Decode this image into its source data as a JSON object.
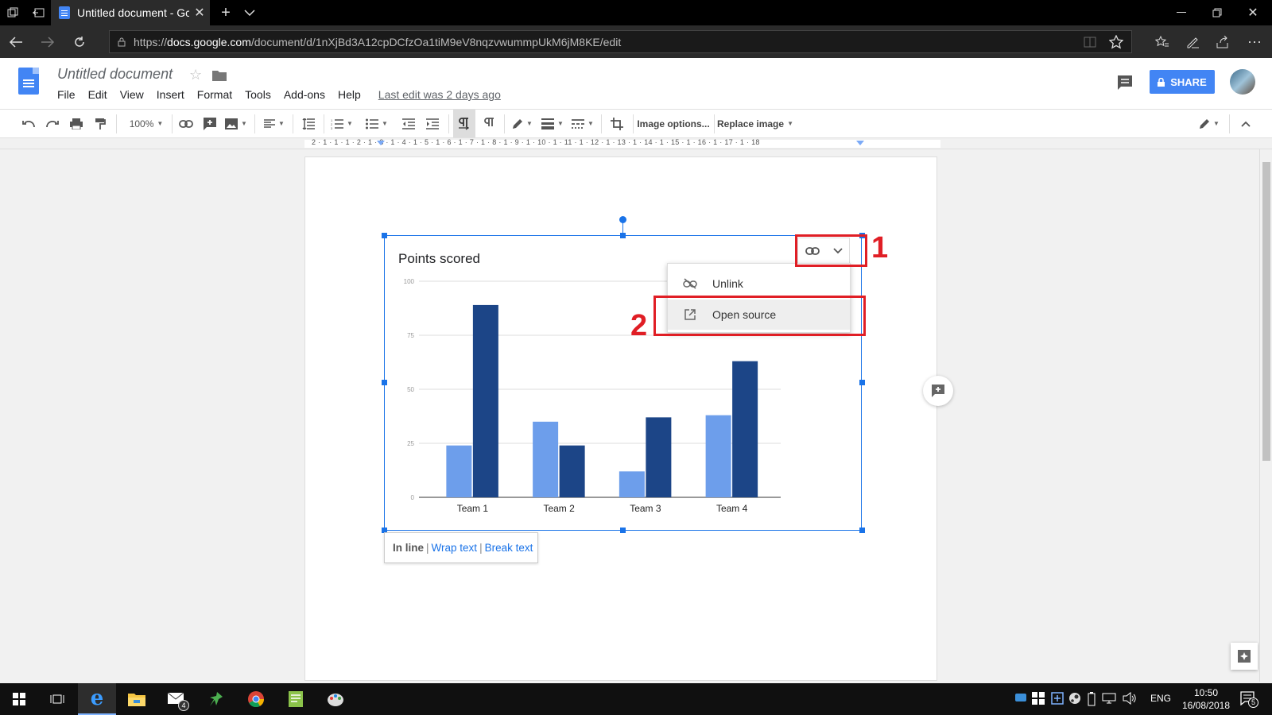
{
  "browser": {
    "tab_title": "Untitled document - Gc",
    "url_prefix": "https://",
    "url_host": "docs.google.com",
    "url_path": "/document/d/1nXjBd3A12cpDCfzOa1tiM9eV8nqzvwummpUkM6jM8KE/edit"
  },
  "docs": {
    "title": "Untitled document",
    "menu": [
      "File",
      "Edit",
      "View",
      "Insert",
      "Format",
      "Tools",
      "Add-ons",
      "Help"
    ],
    "last_edit": "Last edit was 2 days ago",
    "share_label": "SHARE",
    "accent": "#4285f4"
  },
  "toolbar": {
    "zoom": "100%",
    "image_options": "Image options...",
    "replace_image": "Replace image"
  },
  "ruler": {
    "labels": "2 · 1 · 1 · 1 · 2 · 1 · 3 · 1 · 4 · 1 · 5 · 1 · 6 · 1 · 7 · 1 · 8 · 1 · 9 · 1 · 10 · 1 · 11 · 1 · 12 · 1 · 13 · 1 · 14 · 1 · 15 · 1 · 16 · 1 · 17 · 1 · 18"
  },
  "link_menu": {
    "unlink": "Unlink",
    "open_source": "Open source"
  },
  "annotations": {
    "one": "1",
    "two": "2",
    "color": "#e01e25"
  },
  "wrap_options": {
    "inline": "In line",
    "wrap": "Wrap text",
    "break": "Break text",
    "separator": "|"
  },
  "chart_data": {
    "type": "bar",
    "title": "Points scored",
    "categories": [
      "Team 1",
      "Team 2",
      "Team 3",
      "Team 4"
    ],
    "series": [
      {
        "values": [
          24,
          35,
          12,
          38
        ],
        "color": "#6d9eeb"
      },
      {
        "values": [
          89,
          24,
          37,
          63
        ],
        "color": "#1c4587"
      }
    ],
    "yticks": [
      "100",
      "75",
      "50",
      "25",
      "0"
    ],
    "ylim": [
      0,
      100
    ],
    "grid": true
  },
  "taskbar": {
    "lang": "ENG",
    "time": "10:50",
    "date": "16/08/2018",
    "mail_badge": "4",
    "notif_count": "5"
  }
}
